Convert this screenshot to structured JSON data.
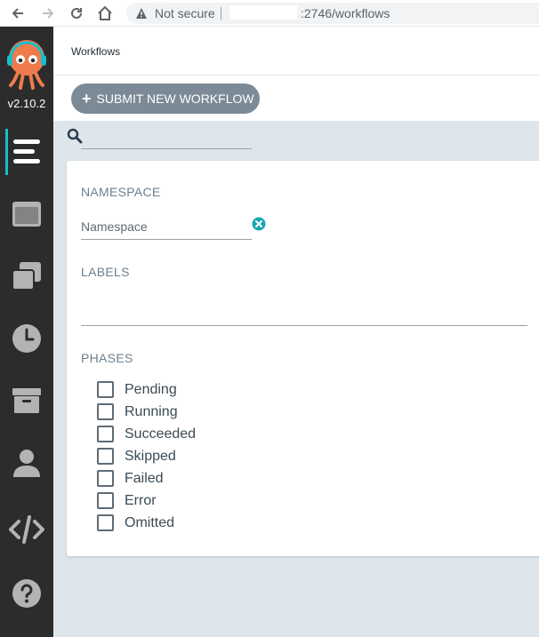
{
  "browser": {
    "security_label": "Not secure",
    "url_tail": ":2746/workflows"
  },
  "sidebar": {
    "version": "v2.10.2",
    "items": [
      {
        "icon": "workflows-icon",
        "active": true
      },
      {
        "icon": "workflow-templates-icon"
      },
      {
        "icon": "cluster-workflow-templates-icon"
      },
      {
        "icon": "cron-workflows-icon"
      },
      {
        "icon": "archived-workflows-icon"
      },
      {
        "icon": "user-icon"
      },
      {
        "icon": "api-docs-icon"
      },
      {
        "icon": "help-icon"
      }
    ]
  },
  "header": {
    "breadcrumb": "Workflows"
  },
  "toolbar": {
    "submit_label": "SUBMIT NEW WORKFLOW"
  },
  "filters": {
    "namespace_title": "NAMESPACE",
    "namespace_placeholder": "Namespace",
    "labels_title": "LABELS",
    "phases_title": "PHASES",
    "phases": [
      {
        "label": "Pending",
        "checked": false
      },
      {
        "label": "Running",
        "checked": false
      },
      {
        "label": "Succeeded",
        "checked": false
      },
      {
        "label": "Skipped",
        "checked": false
      },
      {
        "label": "Failed",
        "checked": false
      },
      {
        "label": "Error",
        "checked": false
      },
      {
        "label": "Omitted",
        "checked": false
      }
    ]
  },
  "colors": {
    "sidebar_bg": "#2c2c2c",
    "accent": "#18bec9",
    "button_bg": "#7b8a96",
    "content_bg": "#dee6eb"
  }
}
